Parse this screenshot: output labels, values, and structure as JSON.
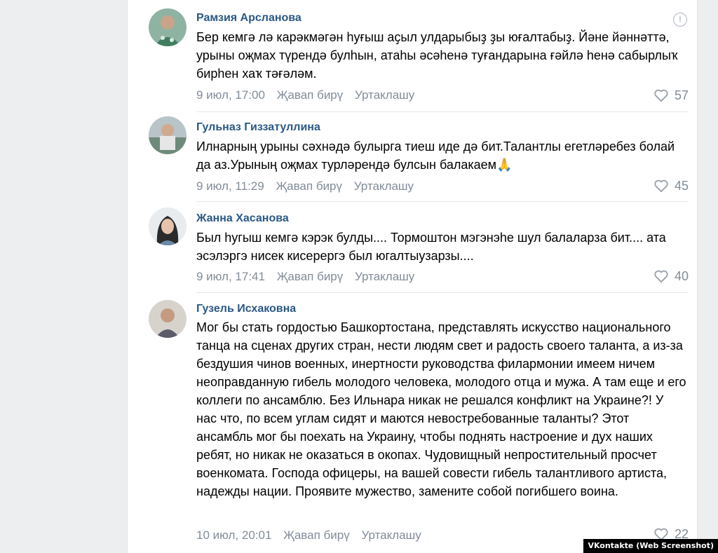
{
  "comments": [
    {
      "author": "Рамзия Арсланова",
      "text": "Бер кемгә лә карәкмәгән һуғыш аҫыл улдарыбыҙ ҙы юғалтабыҙ. Йәне йәннәттә, урыны оҗмах түрендә булһын, атаһы әсәһенә туғандарына ғәйлә һенә сабырлыҡ бирһен хаҡ тәғәләм.",
      "time": "9 июл, 17:00",
      "reply_label": "Җавап бирү",
      "share_label": "Уртаклашу",
      "likes": "57"
    },
    {
      "author": "Гульназ Гиззатуллина",
      "text": "Илнарның урыны сәхнәдә булырга тиеш иде дә бит.Талантлы егетләребез болай да аз.Урының оҗмах турләрендә булсын балакаем🙏",
      "time": "9 июл, 11:29",
      "reply_label": "Җавап бирү",
      "share_label": "Уртаклашу",
      "likes": "45"
    },
    {
      "author": "Жанна Хасанова",
      "text": "Был һугыш кемгә кэрэк булды.... Тормоштон мэгэнэһе шул балаларза бит.... ата эсэлэргэ нисек кисерергэ был югалтыузарзы....",
      "time": "9 июл, 17:41",
      "reply_label": "Җавап бирү",
      "share_label": "Уртаклашу",
      "likes": "40"
    },
    {
      "author": "Гузель Исхаковна",
      "text": "Мог бы стать гордостью Башкортостана, представлять искусство национального танца на сценах других стран, нести людям свет и радость своего таланта, а из-за бездушия чинов военных, инертности руководства филармонии имеем ничем неоправданную гибель молодого человека, молодого отца и мужа. А там еще и его коллеги по ансамблю. Без Ильнара никак не решался конфликт на Украине?! У нас что, по всем углам сидят и маются невостребованные таланты? Этот ансамбль мог бы поехать на Украину, чтобы поднять настроение и дух наших ребят, но никак не оказаться в окопах. Чудовищный непростительный просчет военкомата. Господа офицеры, на вашей совести гибель талантливого артиста, надежды нации. Проявите мужество, замените собой погибшего воина.",
      "time": "10 июл, 20:01",
      "reply_label": "Җавап бирү",
      "share_label": "Уртаклашу",
      "likes": "22"
    }
  ],
  "more_icon_glyph": "!",
  "watermark": "VKontakte (Web Screenshot)",
  "colors": {
    "author": "#2a5885",
    "meta": "#818c99",
    "background": "#edeef0"
  }
}
